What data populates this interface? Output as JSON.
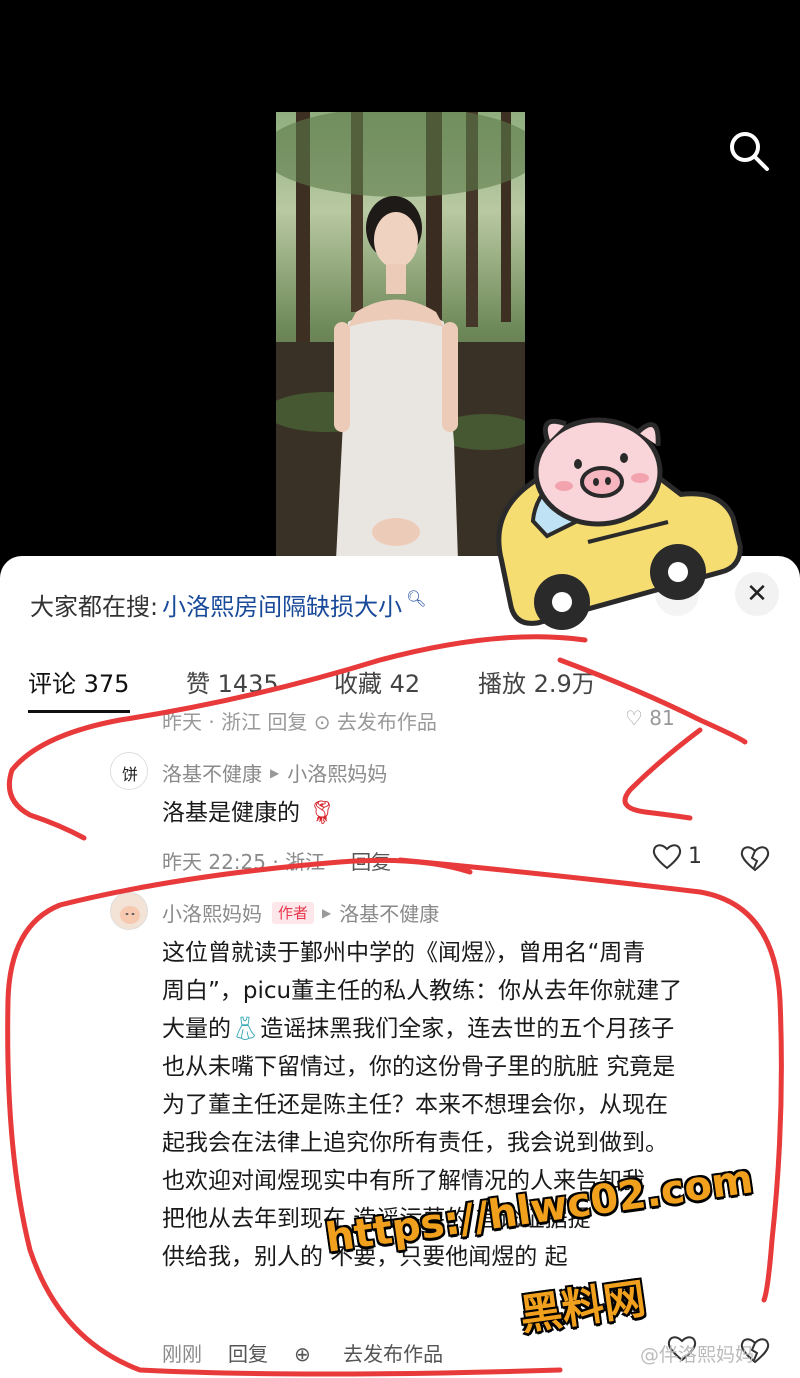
{
  "search_suggestion": {
    "prefix": "大家都在搜:",
    "query": "小洛熙房间隔缺损大小",
    "icon": "search-icon"
  },
  "tabs": [
    {
      "label": "评论 375",
      "active": true
    },
    {
      "label": "赞 1435",
      "active": false
    },
    {
      "label": "收藏 42",
      "active": false
    },
    {
      "label": "播放 2.9万",
      "active": false
    }
  ],
  "partial_row": {
    "meta": "昨天 · 浙江     回复     ⊙ 去发布作品",
    "likes": "♡ 81"
  },
  "comments": [
    {
      "user": "洛基不健康",
      "reply_to": "小洛熙妈妈",
      "text": "洛基是健康的",
      "emoji": "rose-icon",
      "time": "昨天 22:25 · 浙江",
      "reply_label": "回复",
      "likes": "1"
    },
    {
      "user": "小洛熙妈妈",
      "badge": "作者",
      "reply_to": "洛基不健康",
      "lines": [
        "这位曾就读于鄞州中学的《闻煜》，曾用名“周青",
        "周白”，picu董主任的私人教练：你从去年你就建了",
        "大量的",
        "造谣抹黑我们全家，连去世的五个月孩子",
        "也从未嘴下留情过，你的这份骨子里的肮脏 究竟是",
        "为了董主任还是陈主任？本来不想理会你，从现在",
        "起我会在法律上追究你所有责任，我会说到做到。",
        "也欢迎对闻煜现实中有所了解情况的人来告知我",
        "把他从去年到现在 造谣污蔑的 言论证据提",
        "供给我，别人的 不要，只要他闻煜的 起"
      ],
      "emoji": "dress-icon",
      "time": "刚刚",
      "reply_label": "回复",
      "publish_label": "去发布作品"
    }
  ],
  "watermarks": {
    "url": "https://hlwc02.com",
    "site": "黑料网",
    "weibo": "@伴洛熙妈妈"
  },
  "colors": {
    "link": "#1a4a9a",
    "badge_text": "#e8374c",
    "badge_bg": "#fde7ea",
    "annotation": "#e83a3a",
    "watermark": "#f0a01c"
  }
}
